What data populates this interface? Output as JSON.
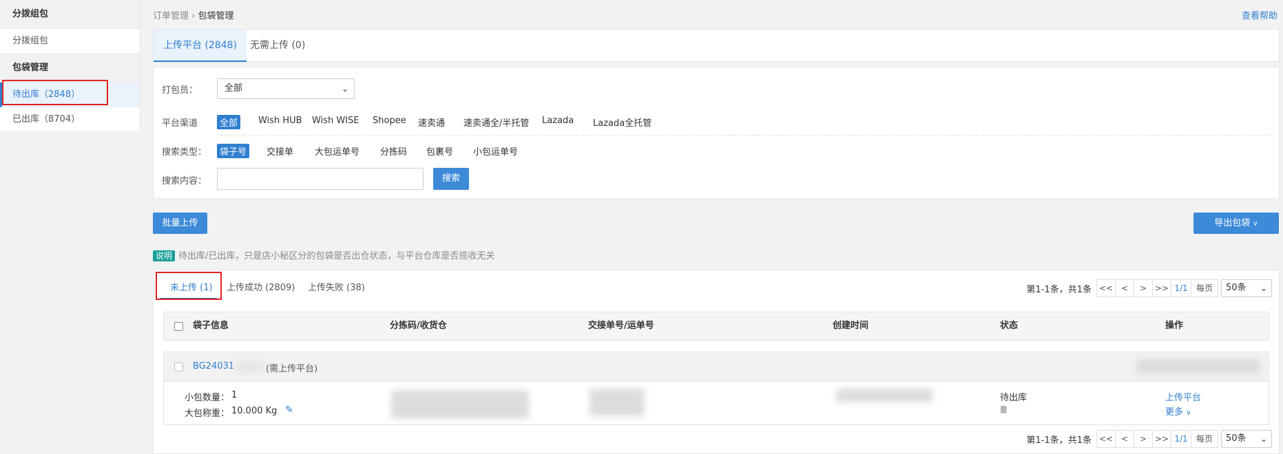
{
  "sidebar": {
    "groups": [
      {
        "title": "分拨组包",
        "items": [
          {
            "label": "分拨组包"
          }
        ]
      },
      {
        "title": "包袋管理",
        "items": [
          {
            "label": "待出库（2848）"
          },
          {
            "label": "已出库（8704）"
          }
        ]
      }
    ]
  },
  "breadcrumb": {
    "parent": "订单管理",
    "separator": "›",
    "current": "包袋管理"
  },
  "help_link": "查看帮助",
  "upper_tabs": [
    {
      "label": "上传平台 (2848)"
    },
    {
      "label": "无需上传 (0)"
    }
  ],
  "filters": {
    "packer_label": "打包员：",
    "packer_value": "全部",
    "platform_label": "平台渠道",
    "platform_options": [
      "全部",
      "Wish HUB",
      "Wish WISE",
      "Shopee",
      "速卖通",
      "速卖通全/半托管",
      "Lazada",
      "Lazada全托管"
    ],
    "search_type_label": "搜索类型：",
    "search_type_options": [
      "袋子号",
      "交接单",
      "大包运单号",
      "分拣码",
      "包裹号",
      "小包运单号"
    ],
    "search_content_label": "搜索内容：",
    "search_placeholder": "",
    "search_button": "搜索"
  },
  "actions": {
    "batch_upload": "批量上传",
    "export_bags": "导出包袋",
    "export_chevron": "∨"
  },
  "note": {
    "badge": "说明",
    "text": "待出库/已出库，只是店小秘区分的包袋是否出仓状态，与平台仓库是否揽收无关"
  },
  "lower_tabs": [
    {
      "label": "未上传 (1)"
    },
    {
      "label": "上传成功 (2809)"
    },
    {
      "label": "上传失败 (38)"
    }
  ],
  "pager": {
    "info": "第1-1条，共1条",
    "first": "<<",
    "prev": "<",
    "next": ">",
    "last": ">>",
    "current": "1/1",
    "per_page_label": "每页",
    "per_page_value": "50条",
    "chevron": "⌄"
  },
  "table": {
    "columns": [
      "袋子信息",
      "分拣码/收货仓",
      "交接单号/运单号",
      "创建时间",
      "状态",
      "操作"
    ],
    "row": {
      "bag_no": "BG24031",
      "bag_note": "(需上传平台)",
      "small_pkg_label": "小包数量：",
      "small_pkg_value": "1",
      "weight_label": "大包称重：",
      "weight_value": "10.000 Kg",
      "status": "待出库",
      "barcode_glyph": "|||||",
      "action_upload": "上传平台",
      "action_more": "更多"
    }
  },
  "colors": {
    "accent": "#2f7fd0",
    "primary_button": "#3c8ad8",
    "highlight": "#e02020",
    "note_badge": "#17a097"
  }
}
